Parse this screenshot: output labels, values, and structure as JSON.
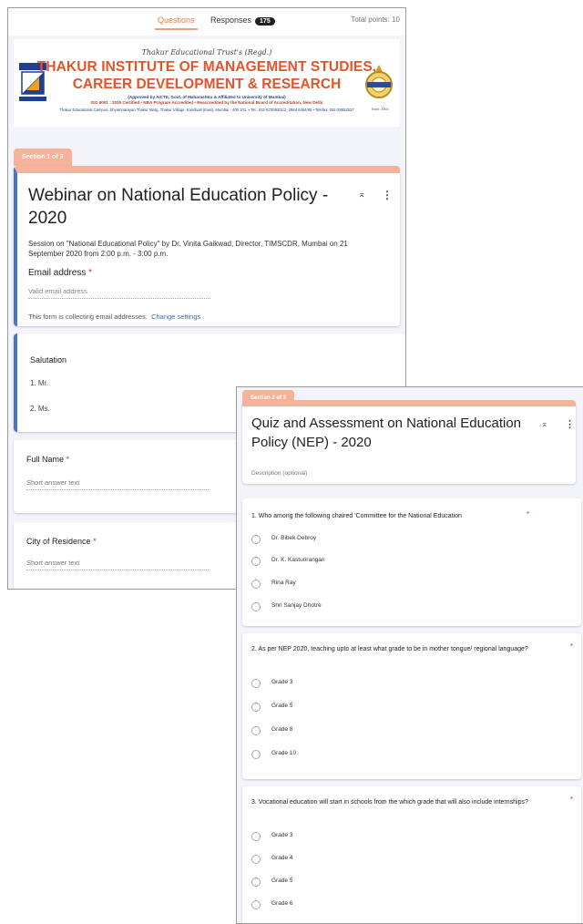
{
  "form1": {
    "tabs": {
      "questions": "Questions",
      "responses": "Responses",
      "responses_count": "175",
      "total_points": "Total points: 10"
    },
    "banner": {
      "script_line": "Thakur Educational Trust's (Regd.)",
      "title_line1": "THAKUR INSTITUTE OF MANAGEMENT STUDIES,",
      "title_line2": "CAREER DEVELOPMENT & RESEARCH",
      "approval_line": "(Approved by AICTE, Govt. of Maharashtra & Affiliated to University of Mumbai)",
      "cert_line": "ISO 9001 : 2015 Certified • NBA Program Accredited • Reaccredited by the National Board of Accreditation, New Delhi",
      "address_line": "Thakur Educational Campus, Shyamnarayan Thakur Marg, Thakur Village, Kandivali (East), Mumbai - 400 101. • Tel.: 022-67308301/2, 2884 6464/65 • Telefax: 022-28852527",
      "estd": "Estd. 2001"
    },
    "section_label": "Section 1 of 3",
    "title": "Webinar on National Education Policy - 2020",
    "description": "Session on \"National Educational Policy\" by Dr. Vinita Gaikwad, Director, TIMSCDR, Mumbai on 21 September 2020 from 2:00 p.m. - 3:00 p.m.",
    "email_label": "Email address",
    "email_placeholder": "Valid email address",
    "email_note": "This form is collecting email addresses.",
    "change_settings": "Change settings",
    "salutation": {
      "label": "Salutation",
      "options": [
        "1.  Mr.",
        "2.  Ms."
      ]
    },
    "full_name": {
      "label": "Full Name",
      "placeholder": "Short answer text"
    },
    "city": {
      "label": "City of Residence",
      "placeholder": "Short answer text"
    }
  },
  "form2": {
    "section_label": "Section 2 of 3",
    "title": "Quiz and Assessment on National Education Policy (NEP) - 2020",
    "description": "Description (optional)",
    "questions": [
      {
        "text": "1. Who among the following chaired 'Committee for the National Education",
        "options": [
          "Dr. Bibek Debroy",
          "Dr. K. Kasturirangan",
          "Rina Ray",
          "Shri Sanjay Dhotre"
        ]
      },
      {
        "text": "2. As per NEP 2020, teaching upto at least what grade to be in mother tongue/ regional language?",
        "options": [
          "Grade 3",
          "Grade 5",
          "Grade 8",
          "Grade 10"
        ]
      },
      {
        "text": "3. Vocational education will start in schools from the which grade that will also include internships?",
        "options": [
          "Grade 3",
          "Grade 4",
          "Grade 5",
          "Grade 6"
        ]
      }
    ]
  },
  "colors": {
    "accent": "#f7b39a",
    "focus_bar": "#4a76c9",
    "banner_title": "#e0552a",
    "required": "#d93025"
  }
}
